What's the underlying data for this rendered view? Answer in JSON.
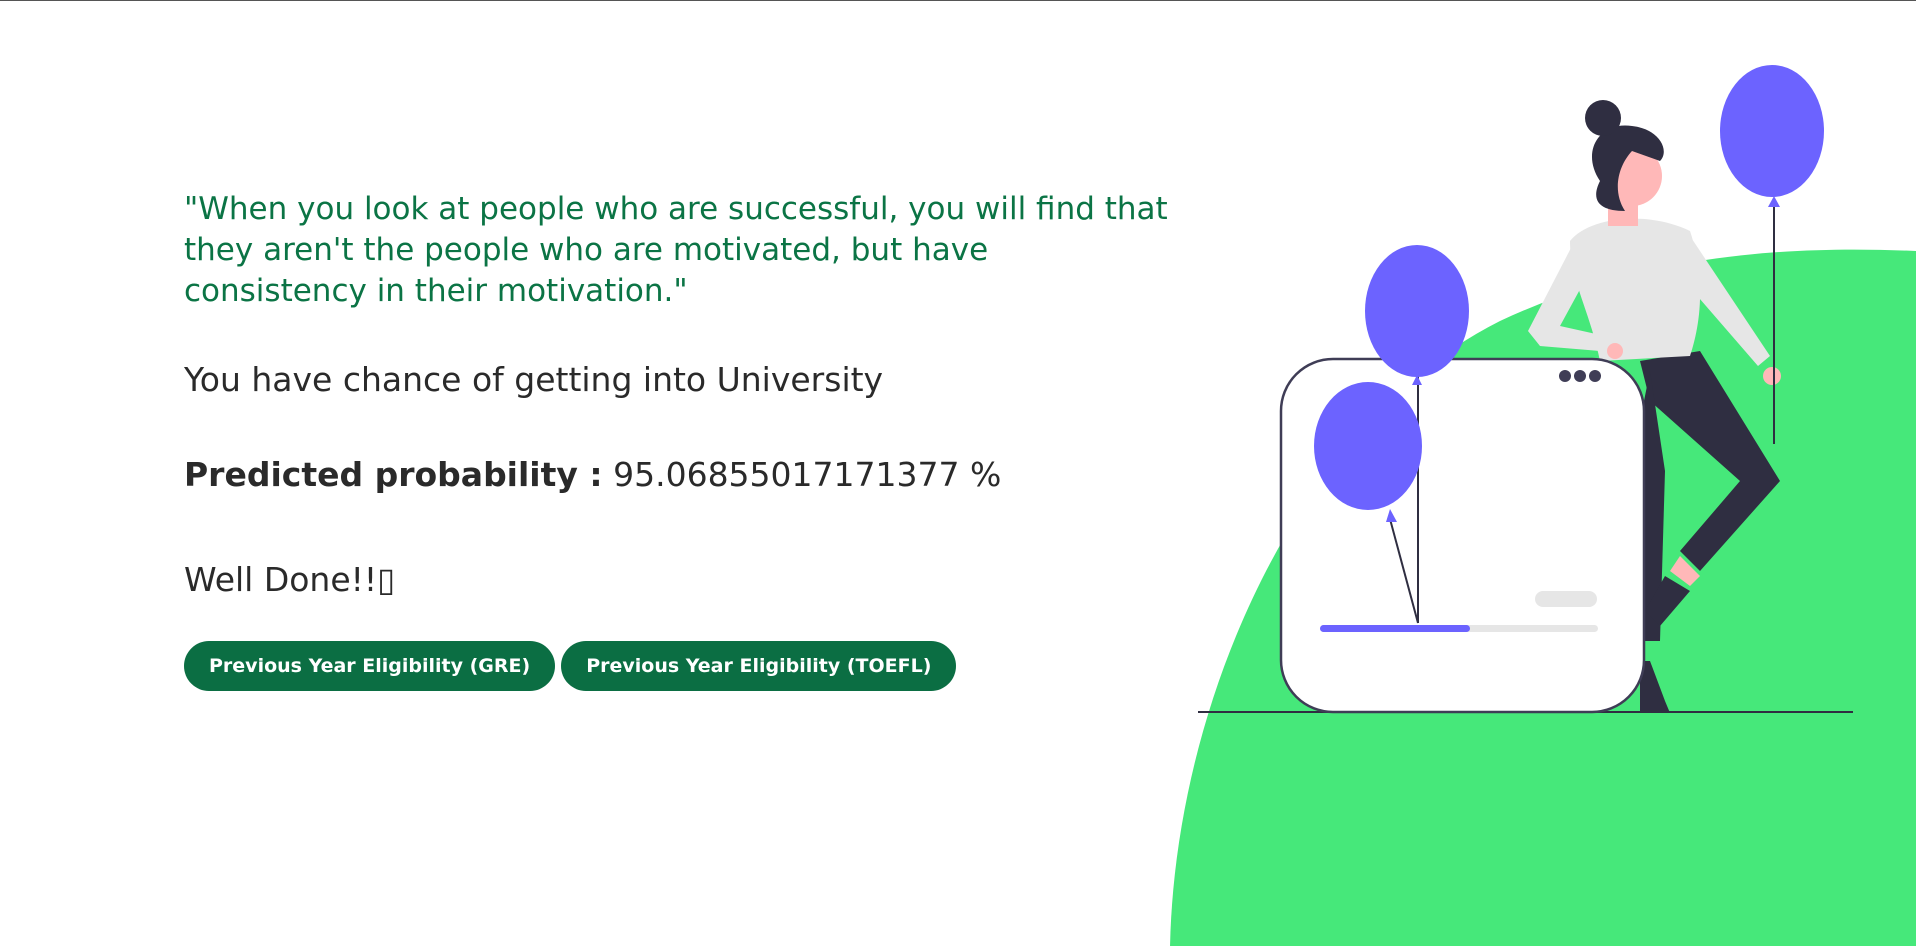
{
  "quote": "\"When you look at people who are successful, you will find that they aren't the people who are motivated, but have consistency in their motivation.\"",
  "chance_text": "You have chance of getting into University",
  "probability": {
    "label": "Predicted probability :",
    "value": "95.06855017171377 %"
  },
  "well_done": "Well Done!!▯",
  "buttons": {
    "gre": "Previous Year Eligibility (GRE)",
    "toefl": "Previous Year Eligibility (TOEFL)"
  },
  "colors": {
    "quote_green": "#0b7445",
    "button_green": "#0b6e43",
    "blob_green": "#46e87a",
    "balloon_purple": "#6c63ff",
    "dark": "#2f2e41"
  },
  "illustration": {
    "icon": "woman-with-balloons-illustration"
  }
}
